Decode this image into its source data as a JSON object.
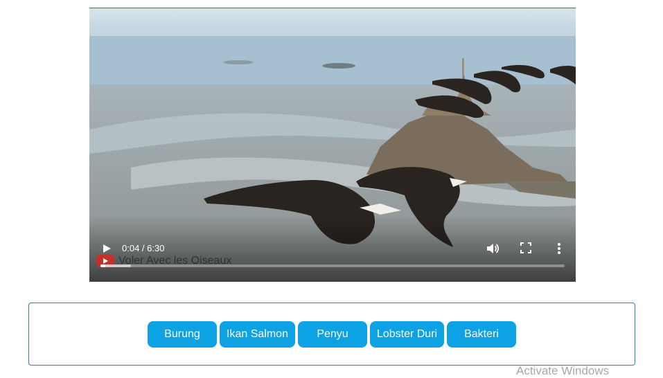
{
  "video": {
    "current_time": "0:04",
    "duration": "6:30",
    "time_display": "0:04 / 6:30",
    "progress_fraction": 0.01,
    "buffered_fraction": 0.065,
    "channel_watermark": "Voler Avec les Oiseaux",
    "icons": {
      "play": "play-icon",
      "volume": "volume-icon",
      "fullscreen": "fullscreen-icon",
      "more": "more-vertical-icon",
      "channel": "youtube-logo-icon"
    }
  },
  "choices": [
    {
      "label": "Burung"
    },
    {
      "label": "Ikan Salmon"
    },
    {
      "label": "Penyu"
    },
    {
      "label": "Lobster Duri"
    },
    {
      "label": "Bakteri"
    }
  ],
  "os_watermark": "Activate Windows",
  "colors": {
    "button_bg": "#0ca2e3",
    "button_text": "#ffffff",
    "panel_border": "#2d7fb5"
  }
}
